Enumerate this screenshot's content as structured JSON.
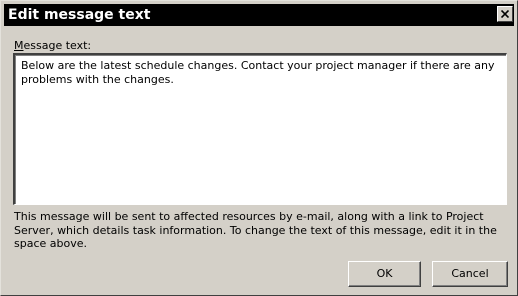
{
  "window": {
    "title": "Edit message text"
  },
  "message": {
    "label_accelerator": "M",
    "label_rest": "essage text:",
    "value": "Below are the latest schedule changes. Contact your project manager if there are any problems with the changes."
  },
  "info": {
    "text": "This message will be sent to affected resources by e-mail, along with a link to Project Server, which details task information. To change the text of this message, edit it in the space above."
  },
  "buttons": {
    "ok_label": "OK",
    "cancel_label": "Cancel"
  },
  "icons": {
    "close": "close-icon"
  }
}
